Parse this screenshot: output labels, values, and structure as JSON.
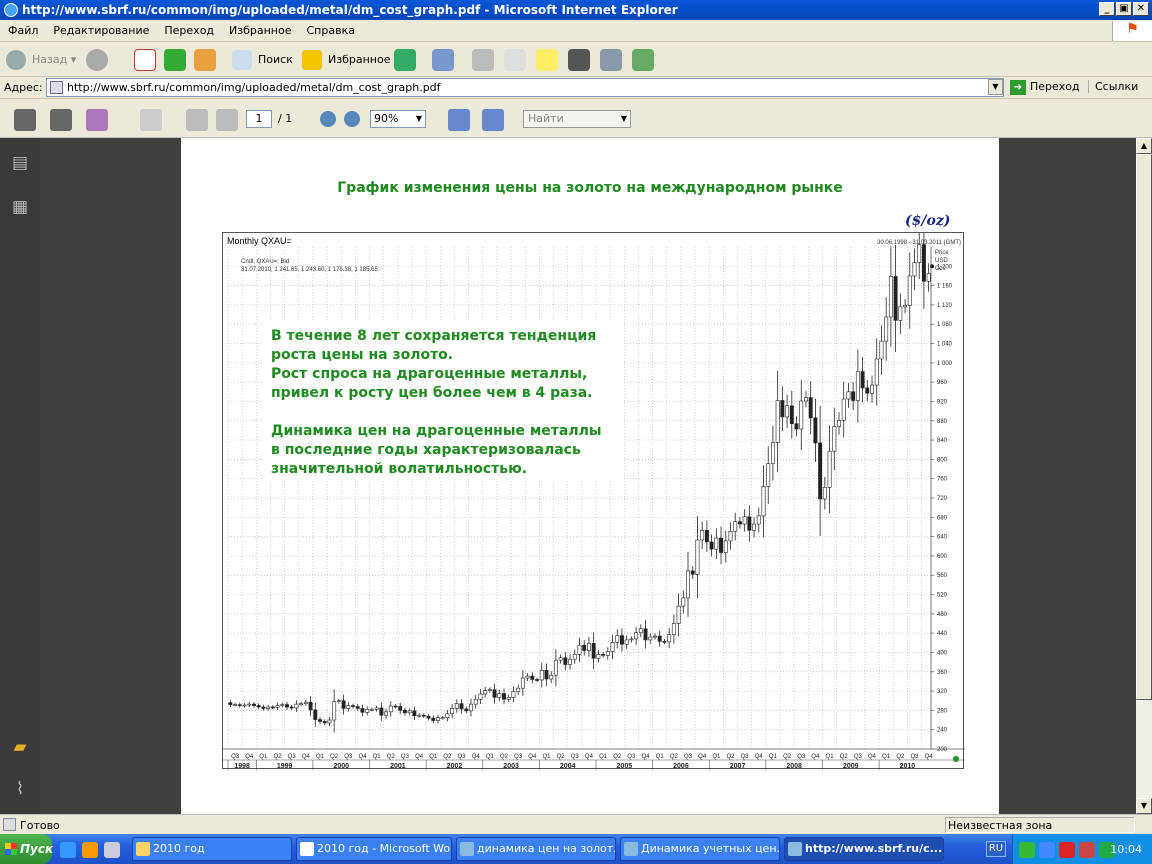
{
  "window": {
    "title": "http://www.sbrf.ru/common/img/uploaded/metal/dm_cost_graph.pdf - Microsoft Internet Explorer"
  },
  "menu": [
    "Файл",
    "Редактирование",
    "Переход",
    "Избранное",
    "Справка"
  ],
  "toolbar": {
    "back": "Назад",
    "search": "Поиск",
    "favorites": "Избранное"
  },
  "address": {
    "label": "Адрес:",
    "url": "http://www.sbrf.ru/common/img/uploaded/metal/dm_cost_graph.pdf",
    "go": "Переход",
    "links": "Ссылки"
  },
  "pdf": {
    "page": "1",
    "total": "/ 1",
    "zoom": "90%",
    "find_placeholder": "Найти"
  },
  "document": {
    "title": "График изменения цены на золото на международном рынке",
    "unit": "($/oz)",
    "annotation": [
      "В течение 8 лет сохраняется тенденция",
      "роста цены на золото.",
      "Рост спроса на драгоценные металлы,",
      "привел к росту цен более чем в 4 раза.",
      "",
      "Динамика цен на драгоценные металлы",
      "в последние годы характеризовалась",
      "значительной волатильностью."
    ]
  },
  "chart_data": {
    "type": "candlestick",
    "title": "Monthly QXAU=",
    "date_range": "30.06.1998 - 31.03.2011 (GMT)",
    "info_line1": "Cndl; QXAU=; Bid",
    "info_line2": "31.07.2010, 1 241.65, 1 243.60, 1 176.38, 1 185.65",
    "axis_title": [
      "Price",
      "USD",
      "Ozs"
    ],
    "current_price": "1 200",
    "ylim": [
      200,
      1240
    ],
    "y_ticks": [
      "1 200",
      "1 160",
      "1 120",
      "1 080",
      "1 040",
      "1 000",
      "960",
      "920",
      "880",
      "840",
      "800",
      "760",
      "720",
      "680",
      "640",
      "600",
      "560",
      "520",
      "480",
      "440",
      "400",
      "360",
      "320",
      "280",
      "240",
      "200"
    ],
    "years": [
      "1998",
      "1999",
      "2000",
      "2001",
      "2002",
      "2003",
      "2004",
      "2005",
      "2006",
      "2007",
      "2008",
      "2009",
      "2010"
    ],
    "quarter_labels_first": [
      "Q3",
      "Q4"
    ],
    "quarter_labels_full": [
      "Q1",
      "Q2",
      "Q3",
      "Q4"
    ],
    "close_prices": [
      292,
      292,
      290,
      291,
      293,
      290,
      287,
      284,
      287,
      286,
      290,
      292,
      287,
      285,
      293,
      294,
      297,
      281,
      261,
      257,
      254,
      260,
      298,
      300,
      284,
      290,
      288,
      284,
      276,
      282,
      282,
      285,
      270,
      277,
      289,
      288,
      280,
      275,
      279,
      269,
      270,
      268,
      264,
      259,
      265,
      265,
      273,
      284,
      294,
      283,
      279,
      293,
      303,
      314,
      321,
      323,
      307,
      315,
      303,
      307,
      319,
      326,
      347,
      351,
      344,
      343,
      363,
      345,
      353,
      384,
      389,
      375,
      386,
      396,
      415,
      404,
      419,
      388,
      396,
      394,
      402,
      421,
      435,
      417,
      426,
      428,
      441,
      449,
      426,
      432,
      434,
      423,
      422,
      437,
      460,
      496,
      513,
      569,
      562,
      633,
      653,
      629,
      614,
      637,
      607,
      631,
      651,
      671,
      666,
      681,
      653,
      666,
      683,
      744,
      791,
      835,
      922,
      888,
      911,
      874,
      863,
      921,
      928,
      886,
      834,
      718,
      742,
      817,
      868,
      881,
      925,
      940,
      922,
      982,
      948,
      937,
      954,
      1008,
      1045,
      1095,
      1179,
      1088,
      1116,
      1119,
      1180,
      1208,
      1245,
      1169,
      1185
    ]
  },
  "status": {
    "text": "Готово",
    "zone": "Неизвестная зона"
  },
  "taskbar": {
    "start": "Пуск",
    "tasks": [
      "2010 год",
      "2010 год - Microsoft Word",
      "динамика цен на золот...",
      "Динамика учетных цен...",
      "http://www.sbrf.ru/c..."
    ],
    "lang": "RU",
    "clock": "10:04"
  }
}
